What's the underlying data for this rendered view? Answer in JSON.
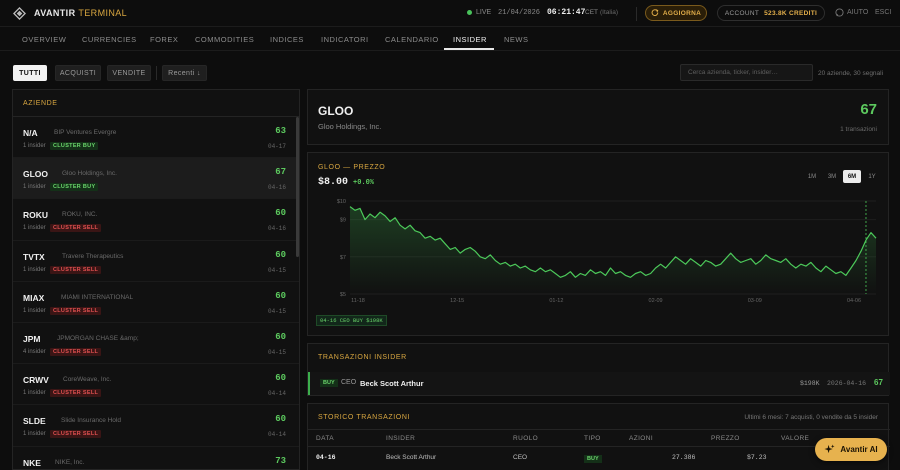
{
  "app": {
    "brand": "AVANTIR",
    "brand_suffix": "TERMINAL",
    "logo_icon": "diamond-logo-icon"
  },
  "status": {
    "live_label": "LIVE",
    "date": "21/04/2026",
    "time": "06:21:47",
    "tz": "CET",
    "locale": "(Italia)"
  },
  "actions": {
    "refresh_label": "AGGIORNA",
    "account_label": "ACCOUNT",
    "account_credits": "523.8K CREDITI",
    "help_label": "AIUTO",
    "exit_label": "ESCI"
  },
  "nav": {
    "items": [
      "OVERVIEW",
      "CURRENCIES",
      "FOREX",
      "COMMODITIES",
      "INDICES",
      "INDICATORI",
      "CALENDARIO",
      "INSIDER",
      "NEWS"
    ],
    "active": "INSIDER"
  },
  "filters": {
    "all": "TUTTI",
    "buys": "ACQUISTI",
    "sells": "VENDITE",
    "sort": "Recenti ↓"
  },
  "search": {
    "placeholder": "Cerca azienda, ticker, insider…",
    "counts": "20 aziende, 30 segnali"
  },
  "companies": {
    "header": "AZIENDE",
    "items": [
      {
        "ticker": "N/A",
        "name": "BIP Ventures Evergre",
        "insiders": "1 insider",
        "signal": "CLUSTER BUY",
        "score": "63",
        "date": "04-17"
      },
      {
        "ticker": "GLOO",
        "name": "Gloo Holdings, Inc.",
        "insiders": "1 insider",
        "signal": "CLUSTER BUY",
        "score": "67",
        "date": "04-16"
      },
      {
        "ticker": "ROKU",
        "name": "ROKU, INC.",
        "insiders": "1 insider",
        "signal": "CLUSTER SELL",
        "score": "60",
        "date": "04-16"
      },
      {
        "ticker": "TVTX",
        "name": "Travere Therapeutics",
        "insiders": "1 insider",
        "signal": "CLUSTER SELL",
        "score": "60",
        "date": "04-15"
      },
      {
        "ticker": "MIAX",
        "name": "MIAMI INTERNATIONAL",
        "insiders": "1 insider",
        "signal": "CLUSTER SELL",
        "score": "60",
        "date": "04-15"
      },
      {
        "ticker": "JPM",
        "name": "JPMORGAN CHASE &amp;",
        "insiders": "4 insider",
        "signal": "CLUSTER SELL",
        "score": "60",
        "date": "04-15"
      },
      {
        "ticker": "CRWV",
        "name": "CoreWeave, Inc.",
        "insiders": "1 insider",
        "signal": "CLUSTER SELL",
        "score": "60",
        "date": "04-14"
      },
      {
        "ticker": "SLDE",
        "name": "Slide Insurance Hold",
        "insiders": "1 insider",
        "signal": "CLUSTER SELL",
        "score": "60",
        "date": "04-14"
      },
      {
        "ticker": "NKE",
        "name": "NIKE, Inc.",
        "insiders": "",
        "signal": "",
        "score": "73",
        "date": ""
      }
    ]
  },
  "detail": {
    "ticker": "GLOO",
    "name": "Gloo Holdings, Inc.",
    "score": "67",
    "tx_count": "1 transazioni"
  },
  "chart_panel": {
    "title": "GLOO — PREZZO",
    "price": "$8.00",
    "change": "+0.0%",
    "ranges": [
      "1M",
      "3M",
      "6M",
      "1Y"
    ],
    "active_range": "6M",
    "marker_label": "04-16 CEO BUY $198K"
  },
  "chart_data": {
    "type": "line",
    "ylim": [
      5,
      10
    ],
    "yticks": [
      "$10",
      "$9",
      "$7",
      "$5"
    ],
    "ytick_values": [
      10,
      9,
      7,
      5
    ],
    "xticks": [
      "11-18",
      "12-15",
      "01-12",
      "02-09",
      "03-09",
      "04-06"
    ],
    "series": [
      {
        "values": [
          9.7,
          9.5,
          9.6,
          9.0,
          9.3,
          9.1,
          9.4,
          9.2,
          8.9,
          9.1,
          8.7,
          8.5,
          8.7,
          8.4,
          8.3,
          8.0,
          8.1,
          7.9,
          8.0,
          7.7,
          7.4,
          7.5,
          7.2,
          7.4,
          7.5,
          7.3,
          7.0,
          6.9,
          7.1,
          6.8,
          6.6,
          6.7,
          6.5,
          6.6,
          6.4,
          6.5,
          6.3,
          6.2,
          6.4,
          6.2,
          6.3,
          6.1,
          5.9,
          6.0,
          6.2,
          5.9,
          6.1,
          6.0,
          6.3,
          6.1,
          6.2,
          6.0,
          6.4,
          6.1,
          6.2,
          6.0,
          5.9,
          6.1,
          6.2,
          6.0,
          6.1,
          6.4,
          6.6,
          6.4,
          6.7,
          7.0,
          6.8,
          6.6,
          6.9,
          6.7,
          6.5,
          6.8,
          6.7,
          6.5,
          6.6,
          6.9,
          7.2,
          6.9,
          6.7,
          6.8,
          6.9,
          6.6,
          6.8,
          7.1,
          6.9,
          6.8,
          6.7,
          6.9,
          6.6,
          6.4,
          6.6,
          6.5,
          6.7,
          6.4,
          6.2,
          6.5,
          6.3,
          6.1,
          6.2,
          6.0,
          6.4,
          6.8,
          7.3,
          7.9,
          8.3,
          8.0
        ]
      }
    ],
    "marker_index": 103
  },
  "transactions": {
    "title": "TRANSAZIONI INSIDER",
    "items": [
      {
        "type": "BUY",
        "role": "CEO",
        "name": "Beck Scott Arthur",
        "value": "$198K",
        "date": "2026-04-16",
        "score": "67"
      }
    ]
  },
  "history": {
    "title": "STORICO TRANSAZIONI",
    "note": "Ultimi 6 mesi: 7 acquisti, 0 vendite da 5 insider",
    "columns": [
      "DATA",
      "INSIDER",
      "RUOLO",
      "TIPO",
      "AZIONI",
      "PREZZO",
      "VALORE"
    ],
    "rows": [
      {
        "date": "04-16",
        "insider": "Beck Scott Arthur",
        "role": "CEO",
        "type": "BUY",
        "shares": "27.386",
        "price": "$7.23",
        "value": ""
      }
    ]
  },
  "ai": {
    "label": "Avantir AI",
    "icon": "sparkles-icon"
  },
  "colors": {
    "accent": "#e7b24e",
    "positive": "#5cc95e",
    "negative": "#e05050",
    "bg": "#0d0d0d"
  }
}
